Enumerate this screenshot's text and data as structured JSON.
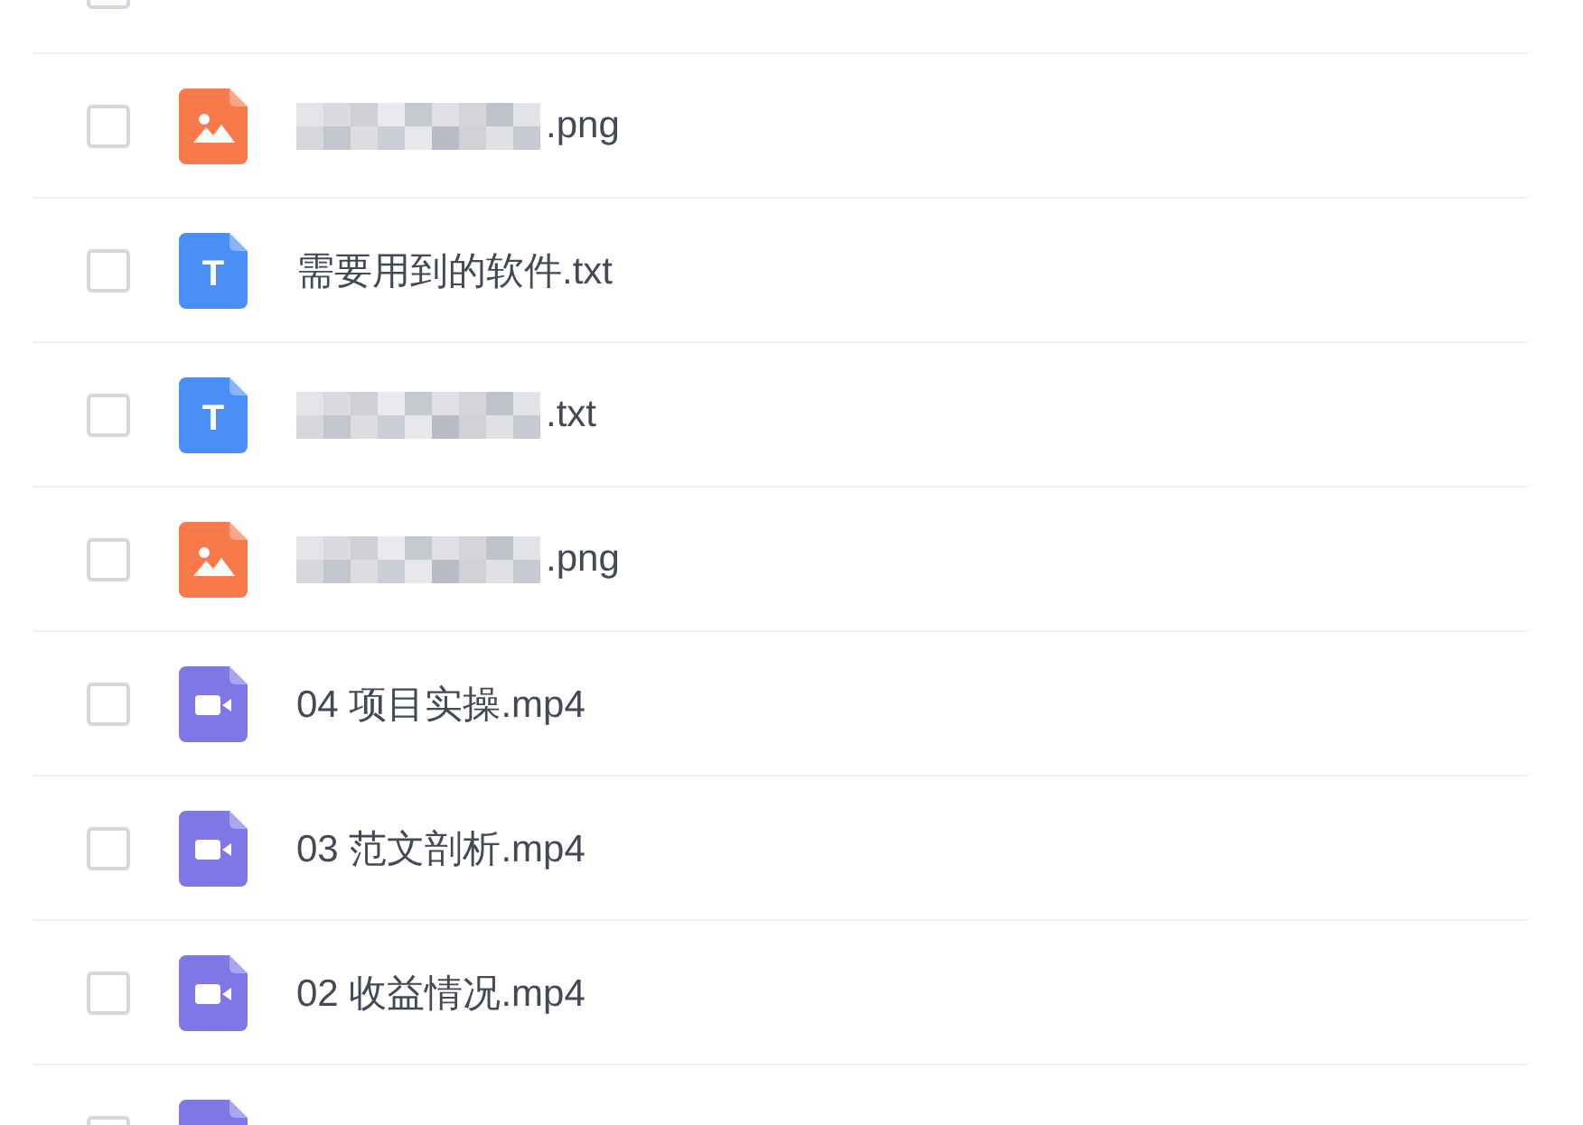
{
  "list": {
    "select_all": {
      "checked": false
    },
    "rows": [
      {
        "kind": "image",
        "blurred": true,
        "name": ".png",
        "checked": false
      },
      {
        "kind": "text",
        "icon_letter": "T",
        "blurred": false,
        "name": "需要用到的软件.txt",
        "checked": false
      },
      {
        "kind": "text",
        "icon_letter": "T",
        "blurred": true,
        "name": ".txt",
        "checked": false
      },
      {
        "kind": "image",
        "blurred": true,
        "name": ".png",
        "checked": false
      },
      {
        "kind": "video",
        "blurred": false,
        "name": "04 项目实操.mp4",
        "checked": false
      },
      {
        "kind": "video",
        "blurred": false,
        "name": "03 范文剖析.mp4",
        "checked": false
      },
      {
        "kind": "video",
        "blurred": false,
        "name": "02 收益情况.mp4",
        "checked": false
      },
      {
        "kind": "video",
        "blurred": false,
        "checked": false
      }
    ]
  }
}
